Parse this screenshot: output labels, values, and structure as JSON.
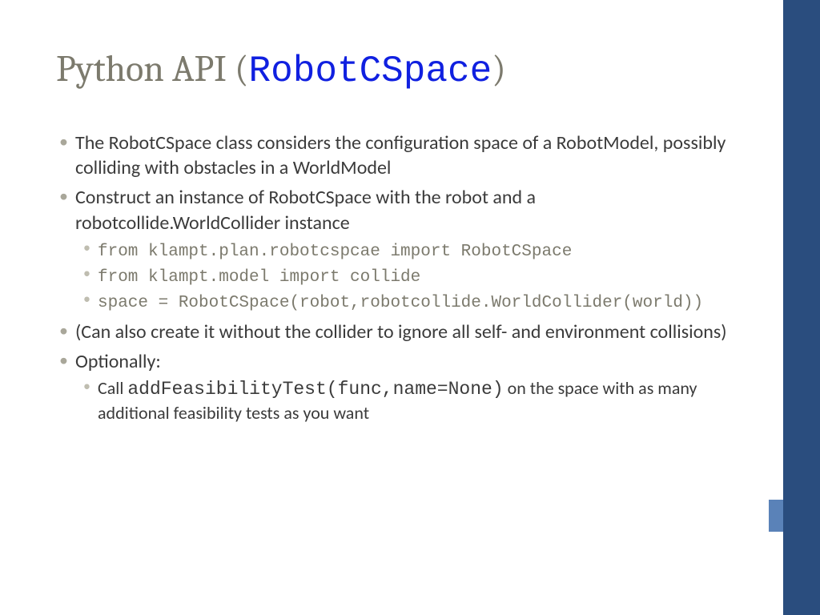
{
  "title": {
    "prefix": "Python API (",
    "highlight": "RobotCSpace",
    "suffix": ")"
  },
  "bullets": {
    "b1": "The RobotCSpace class considers the configuration space of a RobotModel, possibly colliding with obstacles in a WorldModel",
    "b2": "Construct an instance of RobotCSpace with the robot and a robotcollide.WorldCollider instance",
    "b2_code1": "from klampt.plan.robotcspcae import RobotCSpace",
    "b2_code2": "from klampt.model import collide",
    "b2_code3": "space = RobotCSpace(robot,robotcollide.WorldCollider(world))",
    "b3": "(Can also create it without the collider to ignore all self- and environment collisions)",
    "b4": "Optionally:",
    "b4_sub_pre": "Call ",
    "b4_sub_code": "addFeasibilityTest(func,name=None)",
    "b4_sub_post": " on the space with as many additional feasibility tests as you want"
  }
}
